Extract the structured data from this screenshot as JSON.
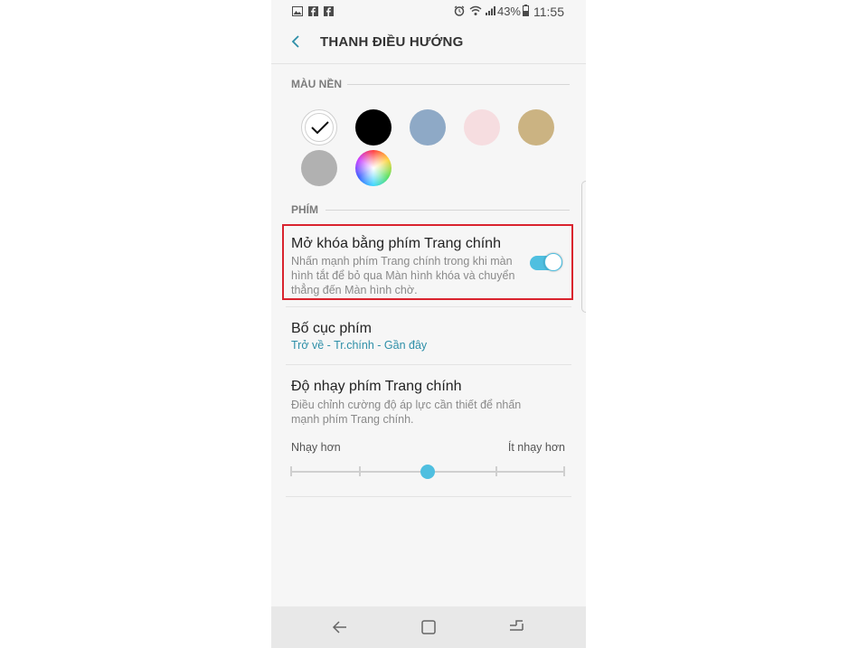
{
  "status_bar": {
    "battery_percent": "43%",
    "time": "11:55",
    "icons": [
      "gallery-icon",
      "facebook-icon",
      "facebook-icon",
      "alarm-icon",
      "wifi-icon",
      "signal-icon",
      "battery-icon"
    ]
  },
  "header": {
    "title": "THANH ĐIỀU HƯỚNG",
    "back_icon": "chevron-left-icon"
  },
  "colors_section": {
    "title": "MÀU NỀN",
    "swatches": [
      {
        "color": "#ffffff",
        "selected": true
      },
      {
        "color": "#000000",
        "selected": false
      },
      {
        "color": "#8ea9c6",
        "selected": false
      },
      {
        "color": "#f6dde0",
        "selected": false
      },
      {
        "color": "#cbb382",
        "selected": false
      },
      {
        "color": "#b1b1b1",
        "selected": false
      },
      {
        "color": "rainbow",
        "selected": false
      }
    ]
  },
  "keys_section": {
    "title": "PHÍM"
  },
  "unlock_setting": {
    "title": "Mở khóa bằng phím Trang chính",
    "desc_line1": "Nhấn mạnh phím Trang chính trong khi màn",
    "desc_line2": "hình tắt để bỏ qua Màn hình khóa và chuyển",
    "desc_line3": "thẳng đến Màn hình chờ.",
    "enabled": true
  },
  "layout_setting": {
    "title": "Bố cục phím",
    "value": "Trở về - Tr.chính - Gần đây"
  },
  "sensitivity_setting": {
    "title": "Độ nhạy phím Trang chính",
    "desc_line1": "Điều chỉnh cường độ áp lực cần thiết để nhấn",
    "desc_line2": "mạnh phím Trang chính.",
    "min_label": "Nhạy hơn",
    "max_label": "Ít nhạy hơn",
    "steps": 5,
    "current_step": 3
  },
  "nav_bar": {
    "buttons": [
      "back-icon",
      "home-icon",
      "recents-icon"
    ]
  },
  "accent_color": "#4fbfe0",
  "highlight_color": "#d9232e"
}
